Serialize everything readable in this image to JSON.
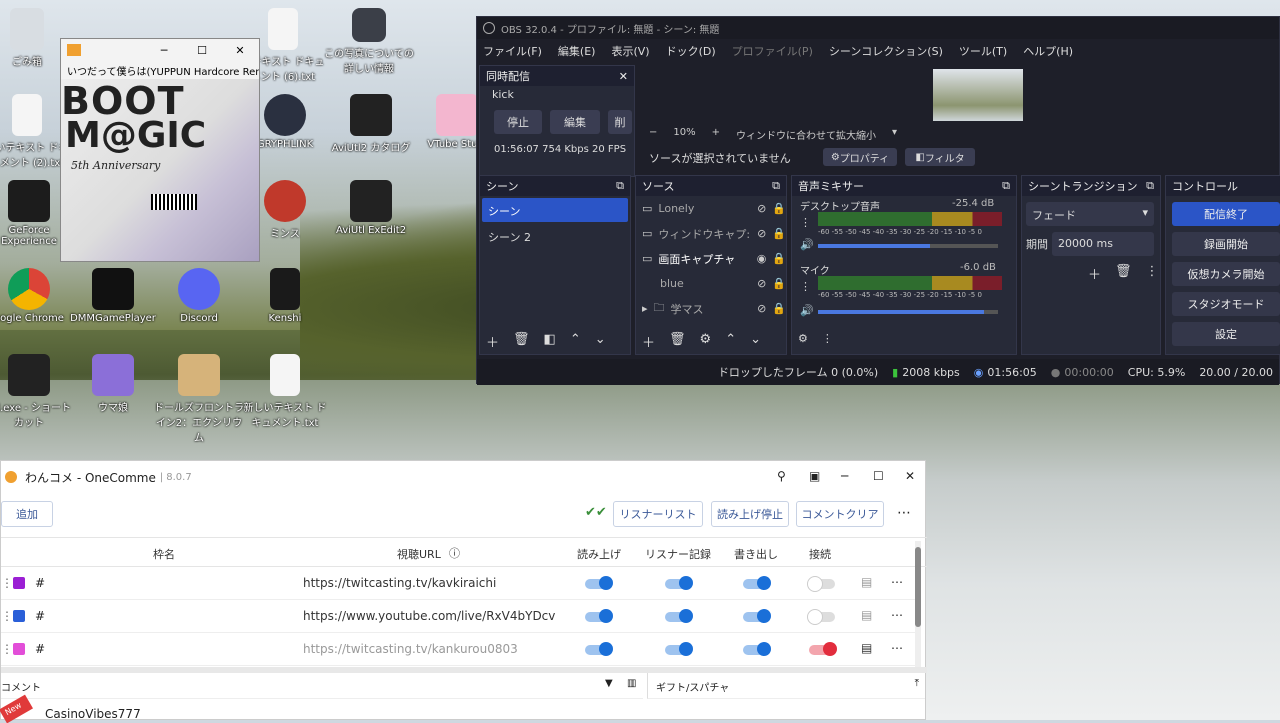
{
  "desktop": {
    "icons": [
      {
        "label": "ごみ箱",
        "icon": "recycle-bin-icon"
      },
      {
        "label": "ルテキスト ドキュメント (6).txt",
        "icon": "text-file-icon"
      },
      {
        "label": "この写真についての詳しい情報",
        "icon": "camera-icon"
      },
      {
        "label": "しいテキスト ドキュメント (2).txt",
        "icon": "text-file-icon"
      },
      {
        "label": "GRYPHLINK",
        "icon": "gryphlink-icon"
      },
      {
        "label": "AviUtl2 カタログ",
        "icon": "aviutl-icon"
      },
      {
        "label": "VTube Studi",
        "icon": "vtube-icon"
      },
      {
        "label": "GeForce Experience",
        "icon": "geforce-icon"
      },
      {
        "label": "ミンス",
        "icon": "chicken-icon"
      },
      {
        "label": "AviUtl ExEdit2",
        "icon": "aviutl-icon"
      },
      {
        "label": "oogle Chrome",
        "icon": "chrome-icon"
      },
      {
        "label": "DMMGamePlayer",
        "icon": "dmm-icon"
      },
      {
        "label": "Discord",
        "icon": "discord-icon"
      },
      {
        "label": "Kenshi",
        "icon": "kenshi-icon"
      },
      {
        "label": "utl.exe - ショートカット",
        "icon": "aviutl-icon"
      },
      {
        "label": "ウマ娘",
        "icon": "umamusume-icon"
      },
      {
        "label": "ドールズフロントライン2：エクシリウム",
        "icon": "dolls-icon"
      },
      {
        "label": "新しいテキスト ドキュメント.txt",
        "icon": "text-file-icon"
      }
    ]
  },
  "player": {
    "title": "いつだって僕らは(YUPPUN Hardcore Remix)",
    "art_text1": "BOOT",
    "art_text2": "M@GIC",
    "art_text3": "5th Anniversary"
  },
  "obs": {
    "title": "OBS 32.0.4 - プロファイル: 無題 - シーン: 無題",
    "menu": [
      "ファイル(F)",
      "編集(E)",
      "表示(V)",
      "ドック(D)",
      "プロファイル(P)",
      "シーンコレクション(S)",
      "ツール(T)",
      "ヘルプ(H)"
    ],
    "multistream": {
      "header": "同時配信",
      "target": "kick",
      "stop": "停止",
      "edit": "編集",
      "del": "削",
      "time": "01:56:07",
      "bitrate": "754 Kbps",
      "fps": "20 FPS"
    },
    "preview": {
      "zoom": "10%",
      "fit": "ウィンドウに合わせて拡大縮小",
      "no_source": "ソースが選択されていません",
      "props": "プロパティ",
      "filters": "フィルタ"
    },
    "scenes": {
      "header": "シーン",
      "items": [
        "シーン",
        "シーン 2"
      ]
    },
    "sources": {
      "header": "ソース",
      "items": [
        "Lonely",
        "ウィンドウキャプ:",
        "画面キャプチャ",
        "blue",
        "学マス"
      ]
    },
    "mixer": {
      "header": "音声ミキサー",
      "ch1": "デスクトップ音声",
      "ch1_db": "-25.4 dB",
      "ch1_level": 0.62,
      "ch2": "マイク",
      "ch2_db": "-6.0 dB",
      "ch2_level": 0.92,
      "ticks": "-60 -55 -50 -45 -40 -35 -30 -25 -20 -15 -10 -5 0"
    },
    "transition": {
      "header": "シーントランジション",
      "type": "フェード",
      "duration_label": "期間",
      "duration": "20000 ms"
    },
    "controls": {
      "header": "コントロール",
      "stream": "配信終了",
      "record": "録画開始",
      "vcam": "仮想カメラ開始",
      "studio": "スタジオモード",
      "settings": "設定"
    },
    "status": {
      "dropped": "ドロップしたフレーム 0 (0.0%)",
      "kbps": "2008 kbps",
      "stream_time": "01:56:05",
      "rec_time": "00:00:00",
      "cpu": "CPU: 5.9%",
      "fps": "20.00 / 20.00"
    }
  },
  "onecomme": {
    "title": "わんコメ - OneComme",
    "version": "8.0.7",
    "add": "追加",
    "listener_list": "リスナーリスト",
    "tts_stop": "読み上げ停止",
    "clear": "コメントクリア",
    "headers": {
      "name": "枠名",
      "url": "視聴URL",
      "tts": "読み上げ",
      "listener": "リスナー記録",
      "export": "書き出し",
      "connect": "接続"
    },
    "rows": [
      {
        "name": "#",
        "url": "https://twitcasting.tv/kavkiraichi",
        "color": "#9b1fd4",
        "connected": false
      },
      {
        "name": "#",
        "url": "https://www.youtube.com/live/RxV4bYDcv",
        "color": "#2a5fd8",
        "connected": false
      },
      {
        "name": "#",
        "url": "https://twitcasting.tv/kankurou0803",
        "color": "#e24ed8",
        "connected": true
      }
    ],
    "comment_header": "コメント",
    "gift_header": "ギフト/スパチャ",
    "first_comment": "CasinoVibes777",
    "new_badge": "New"
  }
}
